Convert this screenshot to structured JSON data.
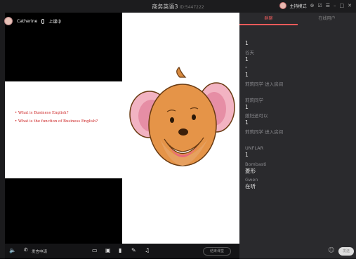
{
  "window": {
    "title": "商务英语3",
    "room_id": "ID:5447222",
    "mode_label": "主持模式",
    "controls": [
      "⊗",
      "☑",
      "☰",
      "–",
      "□",
      "✕"
    ]
  },
  "host": {
    "name": "Catherine",
    "status": "上课中"
  },
  "slide": {
    "bullets": [
      "What is Business English?",
      "What is the function of Business English?"
    ]
  },
  "toolbar": {
    "hand_label": "发言申请",
    "end_label": "结束课堂"
  },
  "panel": {
    "tabs": [
      {
        "label": "群聊",
        "active": true
      },
      {
        "label": "在线用户",
        "active": false
      }
    ]
  },
  "chat": [
    {
      "name": "",
      "text": "1"
    },
    {
      "name": "谷天",
      "text": "1"
    },
    {
      "name": "*",
      "text": "1"
    },
    {
      "system": "莉莉同学 进入房间"
    },
    {
      "name": "莉莉同学",
      "text": "1"
    },
    {
      "name": "媳妇还可以",
      "text": "1"
    },
    {
      "system": "莉莉同学 进入房间"
    },
    {
      "name": "UNFLAR",
      "text": "1"
    },
    {
      "name": "Bombasti",
      "text": "菱形"
    },
    {
      "name": "Gwen",
      "text": "在听"
    }
  ],
  "input": {
    "send_label": "发送"
  }
}
